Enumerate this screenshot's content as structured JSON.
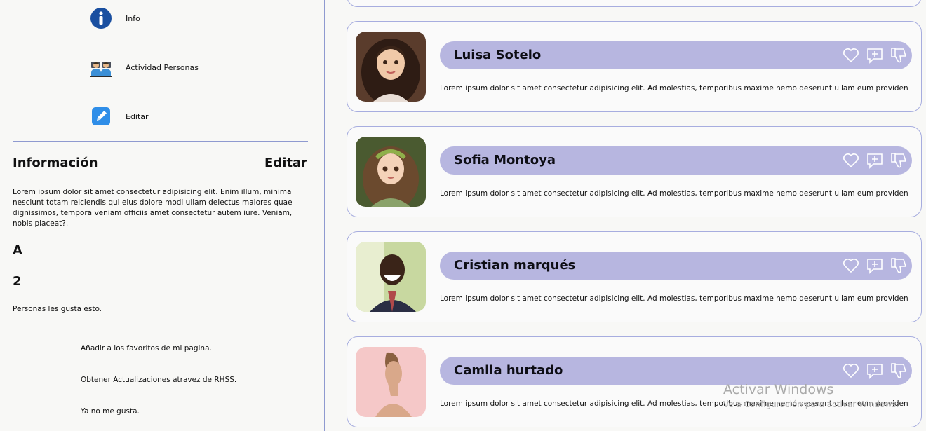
{
  "sidebar": {
    "menu": [
      {
        "label": "Info",
        "icon": "info-icon"
      },
      {
        "label": "Actividad Personas",
        "icon": "people-icon"
      },
      {
        "label": "Editar",
        "icon": "edit-icon"
      }
    ],
    "info_title": "Información",
    "info_edit": "Editar",
    "info_text": "Lorem ipsum dolor sit amet consectetur adipisicing elit. Enim illum, minima nesciunt totam reiciendis qui eius dolore modi ullam delectus maiores quae dignissimos, tempora veniam officiis amet consectetur autem iure. Veniam, nobis placeat?.",
    "stat_letter": "A",
    "stat_count": "2",
    "stat_caption": "Personas les gusta esto.",
    "options": [
      "Añadir a los favoritos de mi pagina.",
      "Obtener Actualizaciones atravez de RHSS.",
      "Ya no me gusta."
    ]
  },
  "feed": {
    "posts": [
      {
        "name": "Luisa Sotelo",
        "text": "Lorem ipsum dolor sit amet consectetur adipisicing elit. Ad molestias, temporibus maxime nemo deserunt ullam eum providen"
      },
      {
        "name": "Sofia Montoya",
        "text": "Lorem ipsum dolor sit amet consectetur adipisicing elit. Ad molestias, temporibus maxime nemo deserunt ullam eum providen"
      },
      {
        "name": "Cristian marqués",
        "text": "Lorem ipsum dolor sit amet consectetur adipisicing elit. Ad molestias, temporibus maxime nemo deserunt ullam eum providen"
      },
      {
        "name": "Camila hurtado",
        "text": "Lorem ipsum dolor sit amet consectetur adipisicing elit. Ad molestias, temporibus maxime nemo deserunt ullam eum providen"
      }
    ],
    "action_icons": [
      "heart-icon",
      "comment-plus-icon",
      "thumbs-down-icon"
    ]
  },
  "watermark": {
    "title": "Activar Windows",
    "subtitle": "Ve a Configuración para activar Windows."
  },
  "colors": {
    "accent": "#b7b6e0",
    "border": "#a7addf",
    "divider": "#8f9ad0",
    "info_blue": "#1a4fa0"
  }
}
